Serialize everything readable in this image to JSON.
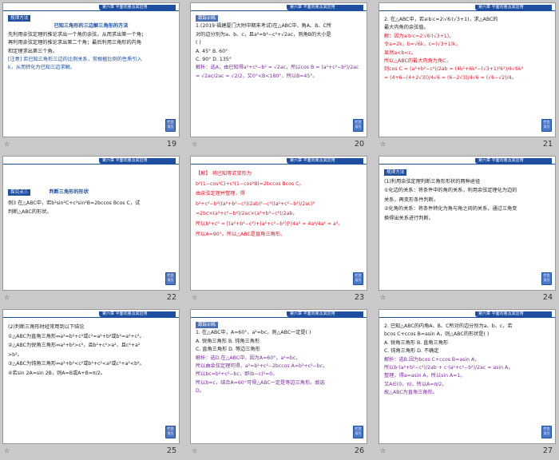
{
  "header_label": "第六章 平面向量及其应用",
  "slides": [
    {
      "num": "19",
      "lines": [
        "规律方法",
        "已知三角形的三边解三角形的方法",
        "先利用余弦定理的推论求出一个角的余弦，从而求出第一个角；",
        "再利用余弦定理的推论求出第二个角；最后利用三角形的内角",
        "和定理求出第三个角。",
        "[注意] 若已知三角形三边的比例关系，常根据比例的性质引入",
        "k，从而转化为已知三边求解。"
      ]
    },
    {
      "num": "20",
      "lines": [
        "跟踪训练",
        "1.(2019·福建厦门大附中期末考试)在△ABC中，角A、B、C所",
        "对的边分别为a、b、c，且a²=b²−c²+√2ac，则角B的大小是",
        "(    )",
        "A. 45°                B. 60°",
        "C. 90°                D. 135°",
        "解析：选A，由已知得a²+c²−b² = √2ac，所以cos B = (a²+c²−b²)/2ac",
        "= √2ac/2ac = √2/2，又0°<B<180°，所以B=45°。"
      ]
    },
    {
      "num": "21",
      "lines": [
        "2. 在△ABC中，若a∶b∶c=2∶√6∶(√3+1)，求△ABC的",
        "最大内角的余弦值。",
        "解：因为a∶b∶c=2∶√6∶(√3+1)，",
        "令a=2k，b=√6k，c=(√3+1)k，",
        "显然a<b<c。",
        "所以△ABC的最大内角为角C，",
        "则cos C = (a²+b²−c²)/2ab = (4k²+6k²−(√3+1)²k²)/4√6k²",
        "= (4+6−(4+2√3))/4√6 = (6−2√3)/4√6 = (√6−√2)/4。"
      ]
    },
    {
      "num": "22",
      "lines": [
        "探究点三",
        "判断三角形的形状",
        "例3 在△ABC中，若b²sin²C+c²sin²B=2bccos Bcos C，试",
        "判断△ABC的形状。"
      ]
    },
    {
      "num": "23",
      "lines": [
        "【解】 将已知等式变形为",
        "b²(1−cos²C)+c²(1−cos²B)=2bccos Bcos C。",
        "由余弦定理并整理，得",
        "b²+c²−b²((a²+b²−c²)/2ab)²−c²((a²+c²−b²)/2ac)²",
        "=2bc×(a²+c²−b²)/2ac×(a²+b²−c²)/2ab，",
        "所以b²+c² = [(a²+b²−c²)+(a²+c²−b²)]²/4a² = 4a⁴/4a² = a²。",
        "所以A=90°。所以△ABC是直角三角形。"
      ]
    },
    {
      "num": "24",
      "lines": [
        "规律方法",
        "(1)利用余弦定理判断三角形形状的两种途径",
        "①化边的关系：将条件中的角的关系，利用余弦定理化为边的",
        "关系，再变形条件判断。",
        "②化角的关系：将条件转化为角与角之间的关系，通过三角变",
        "换得出关系进行判断。"
      ]
    },
    {
      "num": "25",
      "lines": [
        "(2)判断三角形时经常用到以下结论",
        "①△ABC为直角三角形⇔a²=b²+c²或c²=a²+b²或b²=a²+c²。",
        "②△ABC为锐角三角形⇔a²+b²>c²，且b²+c²>a²，且c²+a²",
        ">b²。",
        "③△ABC为钝角三角形⇔a²+b²<c²或b²+c²<a²或c²+a²<b²。",
        "④若sin 2A=sin 2B，则A=B或A+B=π/2。"
      ]
    },
    {
      "num": "26",
      "lines": [
        "跟踪训练",
        "1. 在△ABC中，A=60°，a²=bc，则△ABC一定是(    )",
        "A. 锐角三角形          B. 钝角三角形",
        "C. 直角三角形          D. 等边三角形",
        "解析：选D.在△ABC中，因为A=60°，a²=bc，",
        "所以由余弦定理可得，a²=b²+c²−2bccos A=b²+c²−bc，",
        "所以bc=b²+c²−bc，即(b−c)²=0，",
        "所以b=c，结合A=60°可得△ABC一定是等边三角形。故选",
        "D。"
      ]
    },
    {
      "num": "27",
      "lines": [
        "2. 已知△ABC的内角A、B、C所对的边分别为a、b、c，若",
        "bcos C+ccos B=asin A，则△ABC的形状是(    )",
        "A. 锐角三角形          B. 直角三角形",
        "C. 钝角三角形          D. 不确定",
        "解析：选B.因为bcos C+ccos B=asin A，",
        "所以b·(a²+b²−c²)/2ab + c·(a²+c²−b²)/2ac = asin A，",
        "整理，得a=asin A，所以sin A=1。",
        "又A∈(0，π)，所以A=π/2。",
        "故△ABC为直角三角形。"
      ]
    }
  ],
  "nav_icon_label": "栏目导引",
  "star_glyph": "☆"
}
